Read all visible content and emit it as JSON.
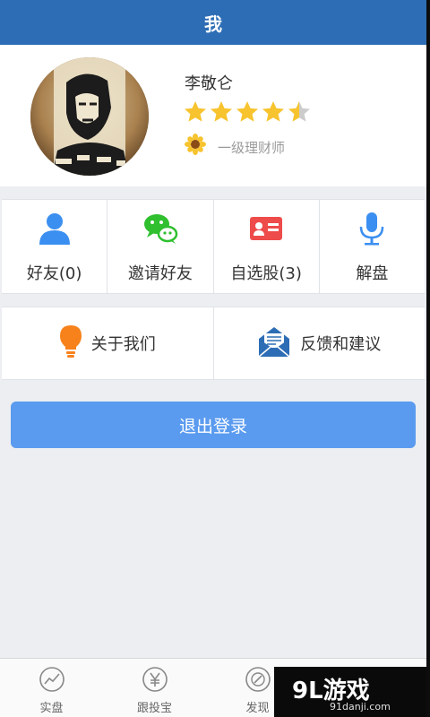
{
  "header": {
    "title": "我"
  },
  "profile": {
    "name": "李敬仑",
    "rating": 4.5,
    "rating_max": 5,
    "level": "一级理财师",
    "star_color": "#f7c32e",
    "star_empty_color": "#cccccc"
  },
  "quick_actions": [
    {
      "label": "好友(0)",
      "icon": "person-icon",
      "color": "#3b8ff0"
    },
    {
      "label": "邀请好友",
      "icon": "wechat-icon",
      "color": "#2fbf2f"
    },
    {
      "label": "自选股(3)",
      "icon": "contact-card-icon",
      "color": "#ee4b4b"
    },
    {
      "label": "解盘",
      "icon": "microphone-icon",
      "color": "#3b8ff0"
    }
  ],
  "info_links": [
    {
      "label": "关于我们",
      "icon": "lightbulb-icon",
      "color": "#f7821b"
    },
    {
      "label": "反馈和建议",
      "icon": "envelope-icon",
      "color": "#2d6db5"
    }
  ],
  "logout": {
    "label": "退出登录"
  },
  "tabbar": [
    {
      "label": "实盘",
      "icon": "chart-circle-icon"
    },
    {
      "label": "跟投宝",
      "icon": "yen-circle-icon"
    },
    {
      "label": "发现",
      "icon": "compass-icon"
    }
  ],
  "watermark": {
    "main": "9L游戏",
    "sub": "91danji.com"
  },
  "colors": {
    "header": "#2d6db5",
    "button": "#5a9bef",
    "background": "#eceef2"
  }
}
